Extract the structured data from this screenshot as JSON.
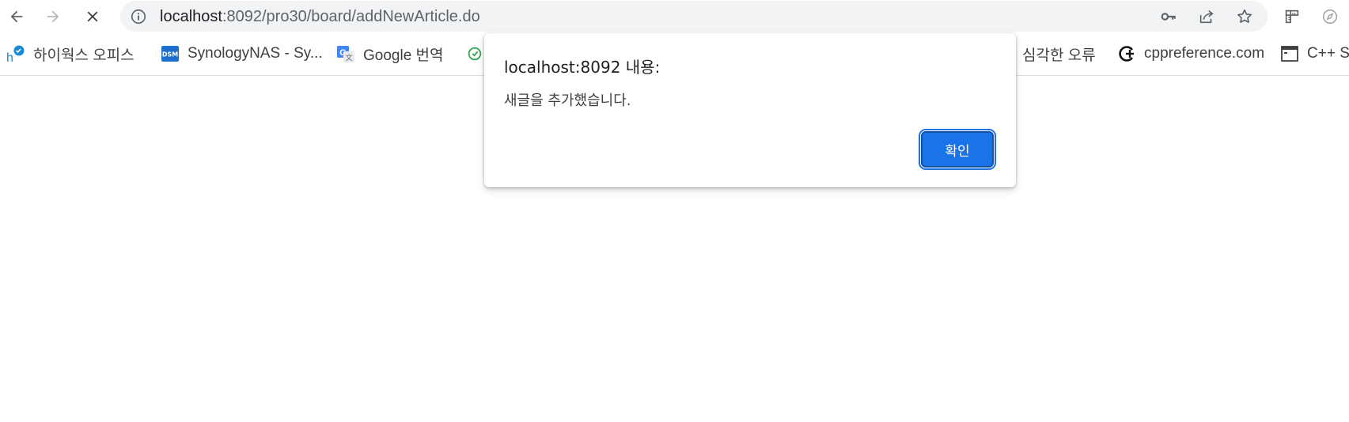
{
  "toolbar": {
    "back_icon": "arrow-left-icon",
    "forward_icon": "arrow-right-icon",
    "stop_icon": "close-icon"
  },
  "omnibox": {
    "url_host": "localhost",
    "url_path": ":8092/pro30/board/addNewArticle.do"
  },
  "bookmarks": [
    {
      "label": "하이웍스 오피스",
      "icon": "hiworks-icon"
    },
    {
      "label": "SynologyNAS - Sy...",
      "icon": "dsm-icon"
    },
    {
      "label": "Google 번역",
      "icon": "google-translate-icon"
    },
    {
      "label": "",
      "icon": "green-circle-icon"
    },
    {
      "label": "심각한 오류",
      "icon": ""
    },
    {
      "label": "cppreference.com",
      "icon": "cppreference-icon"
    },
    {
      "label": "C++ S",
      "icon": "window-icon"
    }
  ],
  "dialog": {
    "title": "localhost:8092 내용:",
    "message": "새글을 추가했습니다.",
    "ok_label": "확인"
  },
  "colors": {
    "accent": "#1a73e8",
    "omnibox_bg": "#f1f3f4",
    "icon_gray": "#5f6368"
  }
}
